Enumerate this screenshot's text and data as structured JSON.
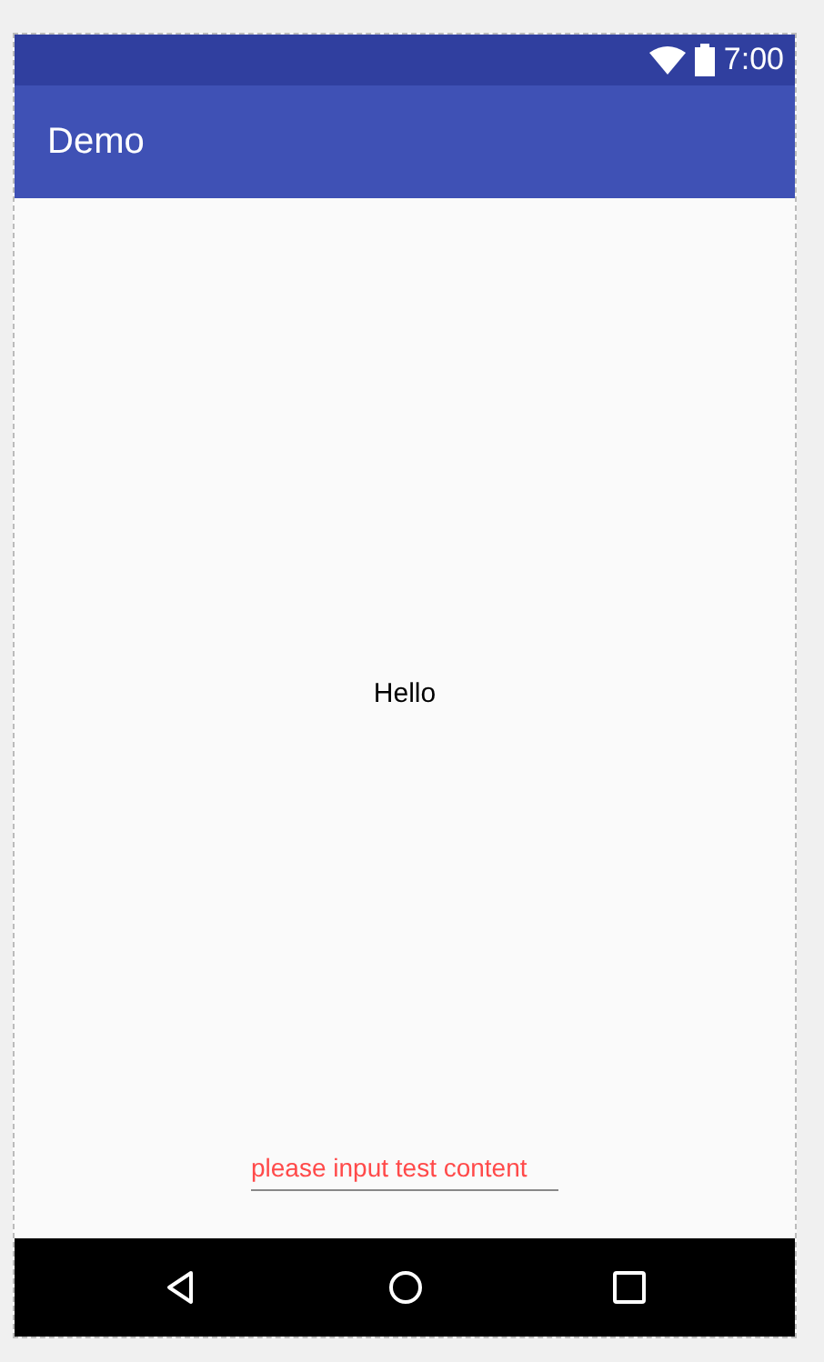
{
  "status_bar": {
    "time": "7:00"
  },
  "app_bar": {
    "title": "Demo"
  },
  "content": {
    "message": "Hello"
  },
  "input": {
    "placeholder": "please input test content"
  },
  "nav_bar": {
    "buttons": [
      {
        "kind": "back"
      },
      {
        "kind": "home"
      },
      {
        "kind": "recents"
      }
    ]
  }
}
